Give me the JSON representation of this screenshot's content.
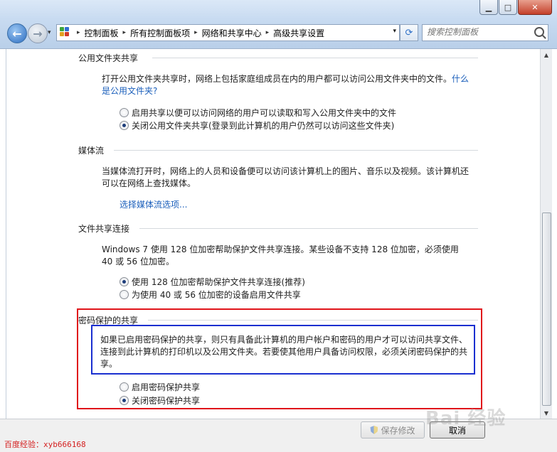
{
  "window": {
    "minimize_glyph": "▁",
    "maximize_glyph": "□",
    "close_glyph": "✕"
  },
  "nav": {
    "back_glyph": "←",
    "forward_glyph": "→",
    "history_glyph": "▾",
    "breadcrumbs": [
      "控制面板",
      "所有控制面板项",
      "网络和共享中心",
      "高级共享设置"
    ],
    "sep_glyph": "▸",
    "dropdown_glyph": "▾",
    "refresh_glyph": "⟳",
    "search_placeholder": "搜索控制面板"
  },
  "sections": {
    "public_folder": {
      "title": "公用文件夹共享",
      "description": "打开公用文件夹共享时，网络上包括家庭组成员在内的用户都可以访问公用文件夹中的文件。",
      "help_link": "什么是公用文件夹?",
      "options": [
        {
          "label": "启用共享以便可以访问网络的用户可以读取和写入公用文件夹中的文件",
          "selected": false
        },
        {
          "label": "关闭公用文件夹共享(登录到此计算机的用户仍然可以访问这些文件夹)",
          "selected": true
        }
      ]
    },
    "media_streaming": {
      "title": "媒体流",
      "description": "当媒体流打开时，网络上的人员和设备便可以访问该计算机上的图片、音乐以及视频。该计算机还可以在网络上查找媒体。",
      "link": "选择媒体流选项..."
    },
    "file_sharing": {
      "title": "文件共享连接",
      "description": "Windows 7 使用 128 位加密帮助保护文件共享连接。某些设备不支持 128 位加密，必须使用 40 或 56 位加密。",
      "options": [
        {
          "label": "使用 128 位加密帮助保护文件共享连接(推荐)",
          "selected": true
        },
        {
          "label": "为使用 40 或 56 位加密的设备启用文件共享",
          "selected": false
        }
      ]
    },
    "password_protected": {
      "title": "密码保护的共享",
      "description": "如果已启用密码保护的共享，则只有具备此计算机的用户帐户和密码的用户才可以访问共享文件、连接到此计算机的打印机以及公用文件夹。若要使其他用户具备访问权限，必须关闭密码保护的共享。",
      "options": [
        {
          "label": "启用密码保护共享",
          "selected": false
        },
        {
          "label": "关闭密码保护共享",
          "selected": true
        }
      ]
    }
  },
  "footer": {
    "save_label": "保存修改",
    "cancel_label": "取消"
  },
  "scroll": {
    "up_glyph": "▲",
    "down_glyph": "▼"
  },
  "watermarks": {
    "brand": "Bai 经验",
    "author": "百度经验：xyb666168"
  },
  "colors": {
    "highlight_red": "#e0141a",
    "highlight_blue": "#1a2fd0",
    "link": "#1b5fbb"
  }
}
